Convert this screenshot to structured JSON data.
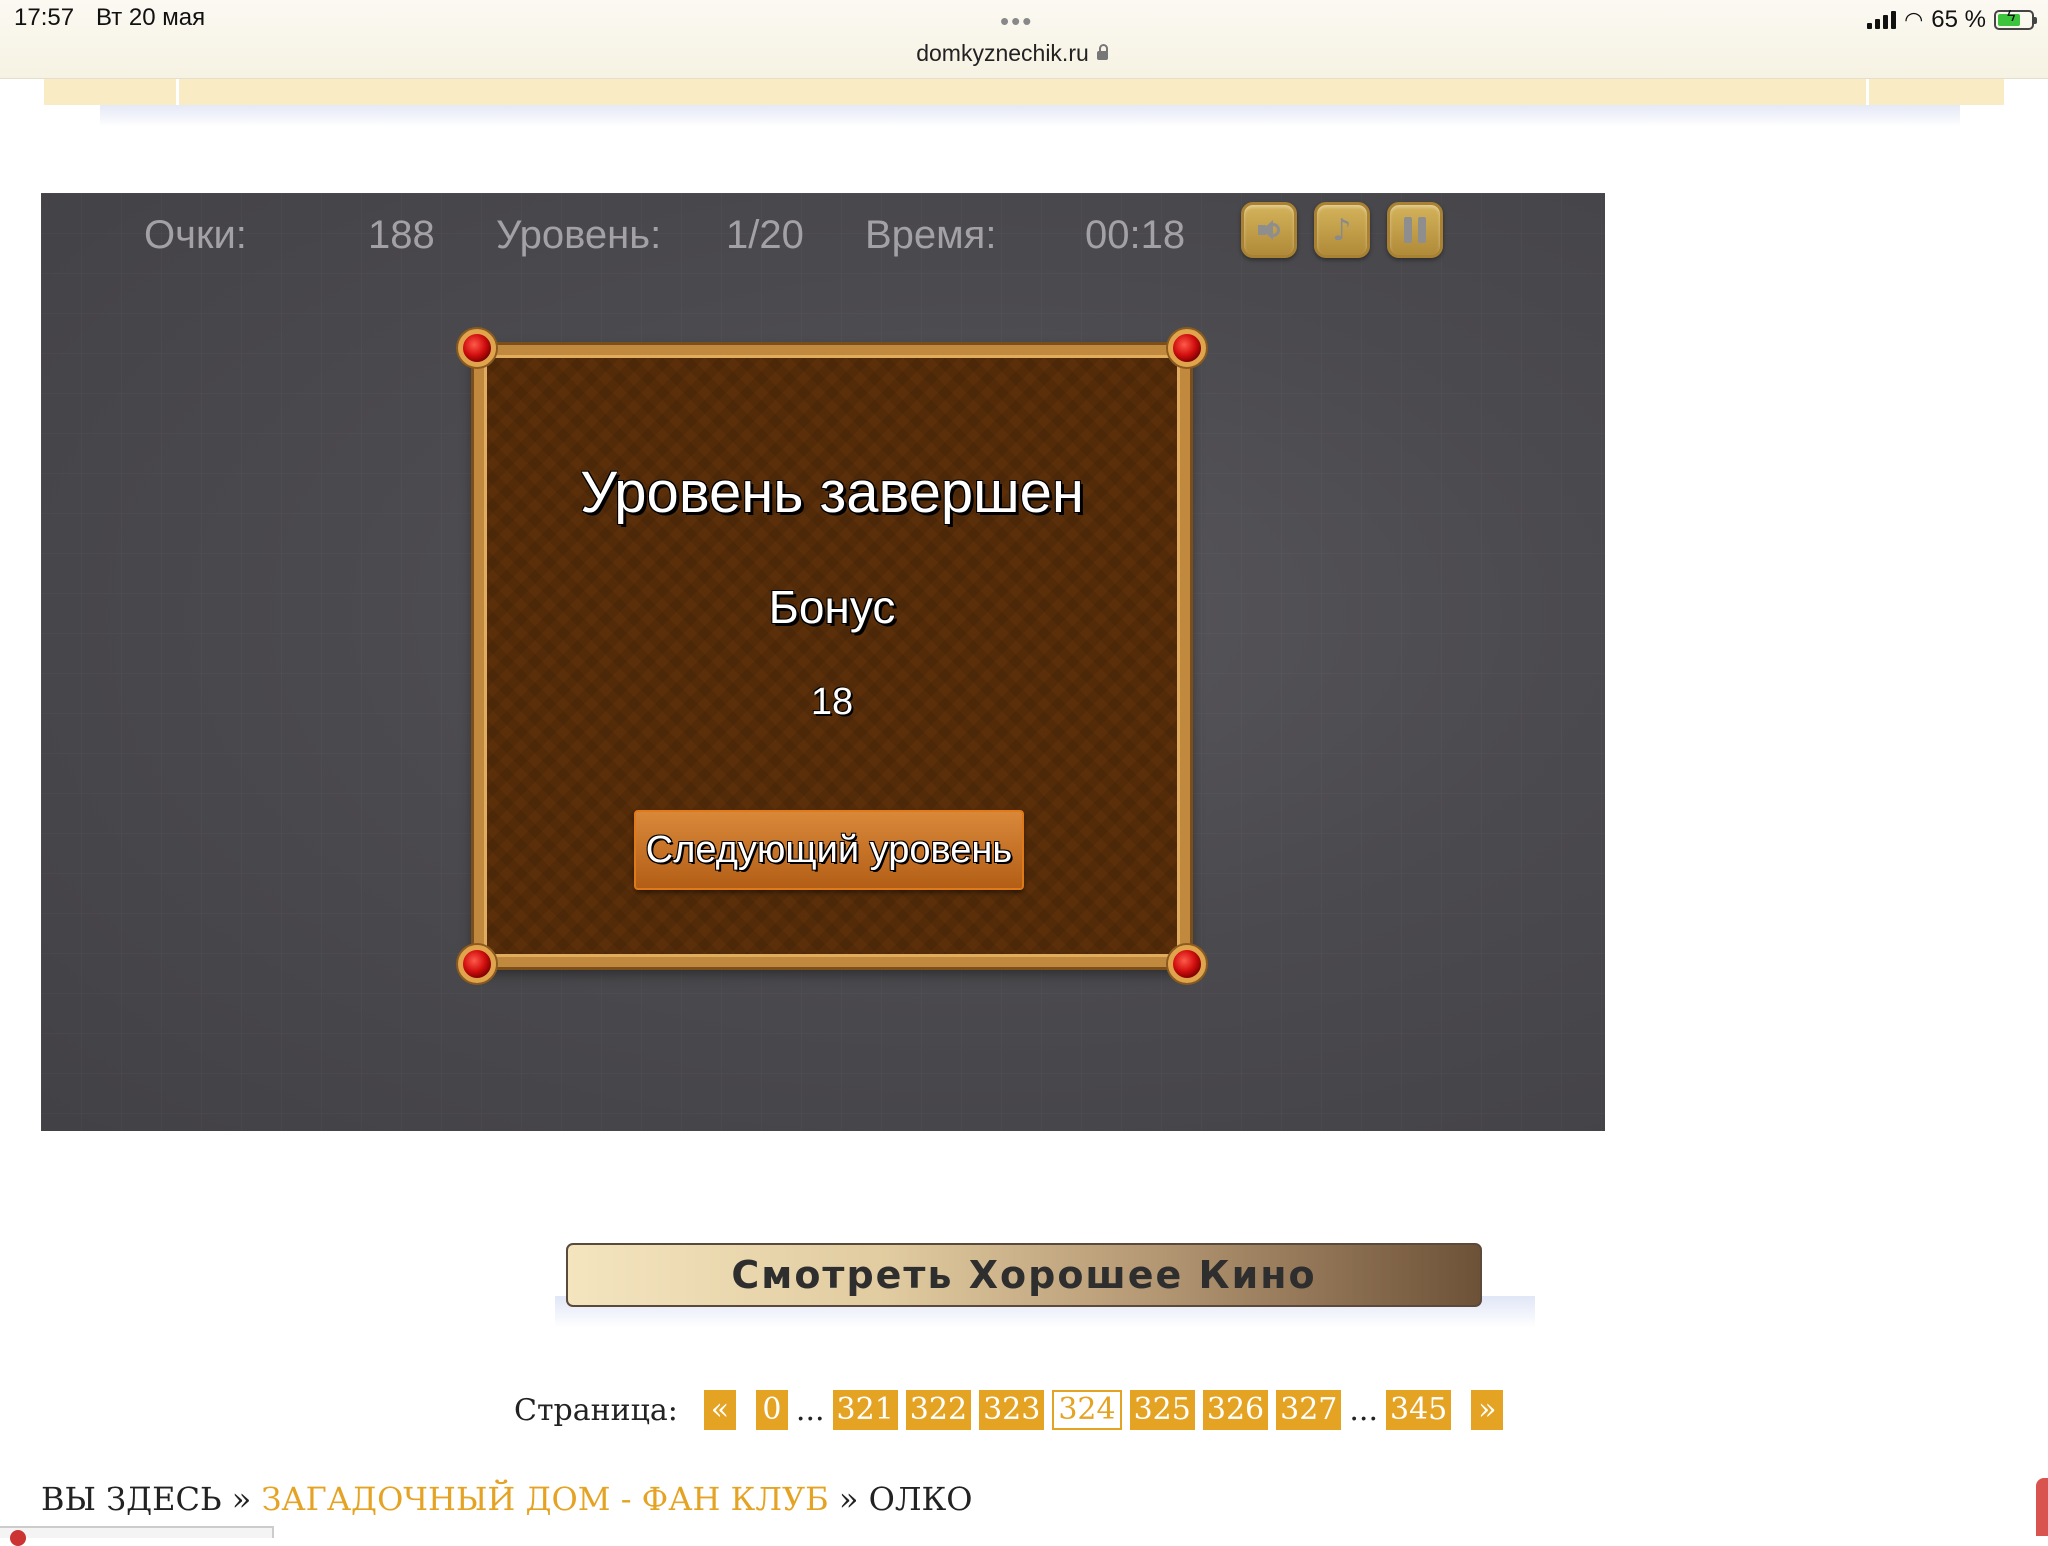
{
  "status_bar": {
    "time": "17:57",
    "date": "Вт 20 мая",
    "url": "domkyznechik.ru",
    "battery": "65 %"
  },
  "game": {
    "hud": {
      "score_label": "Очки:",
      "score_value": "188",
      "level_label": "Уровень:",
      "level_value": "1/20",
      "time_label": "Время:",
      "time_value": "00:18"
    },
    "dialog": {
      "title": "Уровень завершен",
      "bonus_label": "Бонус",
      "bonus_value": "18",
      "next_button": "Следующий уровень"
    }
  },
  "promo": {
    "label": "Смотреть Хорошее Кино"
  },
  "pagination": {
    "label": "Страница:",
    "prev": "«",
    "first": "0",
    "ellipsis": "...",
    "pages": [
      "321",
      "322",
      "323",
      "324",
      "325",
      "326",
      "327"
    ],
    "current": "324",
    "last": "345",
    "next": "»"
  },
  "breadcrumb": {
    "prefix": "ВЫ ЗДЕСЬ",
    "separator": "»",
    "link": "ЗАГАДОЧНЫЙ ДОМ - ФАН КЛУБ",
    "current": "ОЛКО"
  },
  "colors": {
    "accent": "#e5a324",
    "game_background": "#4b4a4e",
    "dialog_background": "#5a2f0a",
    "hud_text": "#a3a1a6"
  },
  "icons": [
    "lock-icon",
    "signal-icon",
    "wifi-icon",
    "battery-icon",
    "speaker-icon",
    "music-note-icon",
    "pause-icon",
    "gem-icon"
  ]
}
